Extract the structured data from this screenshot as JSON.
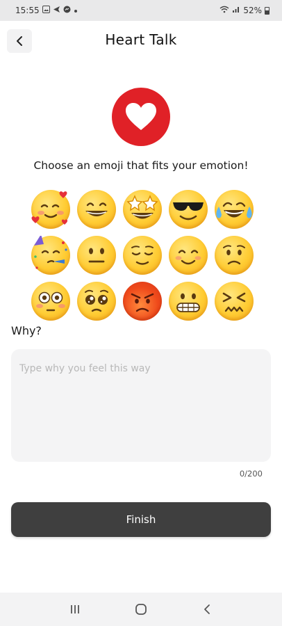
{
  "status_bar": {
    "time": "15:55",
    "battery": "52%",
    "icons": [
      "image-icon",
      "send-icon",
      "messenger-icon",
      "dot-icon",
      "wifi-icon",
      "signal-icon",
      "battery-icon"
    ]
  },
  "header": {
    "title": "Heart Talk",
    "back_icon": "chevron-left-icon"
  },
  "logo": {
    "icon": "heart-icon",
    "color": "#e02127"
  },
  "prompt": "Choose an emoji that fits your emotion!",
  "emojis": [
    {
      "name": "smiling-face-with-hearts"
    },
    {
      "name": "grinning-face-with-smiling-eyes"
    },
    {
      "name": "star-struck"
    },
    {
      "name": "smiling-face-with-sunglasses"
    },
    {
      "name": "face-with-tears-of-joy"
    },
    {
      "name": "partying-face"
    },
    {
      "name": "neutral-face"
    },
    {
      "name": "relieved-face"
    },
    {
      "name": "smiling-face"
    },
    {
      "name": "worried-face"
    },
    {
      "name": "flushed-face"
    },
    {
      "name": "pleading-face"
    },
    {
      "name": "angry-face"
    },
    {
      "name": "grimacing-face"
    },
    {
      "name": "confounded-face"
    }
  ],
  "why": {
    "label": "Why?",
    "placeholder": "Type why you feel this way",
    "value": "",
    "counter": "0/200"
  },
  "finish_label": "Finish",
  "nav_bar": {
    "items": [
      "recent-apps-icon",
      "home-icon",
      "back-icon"
    ]
  },
  "colors": {
    "accent": "#e02127",
    "button": "#3f3f3f",
    "input_bg": "#f4f4f5"
  }
}
